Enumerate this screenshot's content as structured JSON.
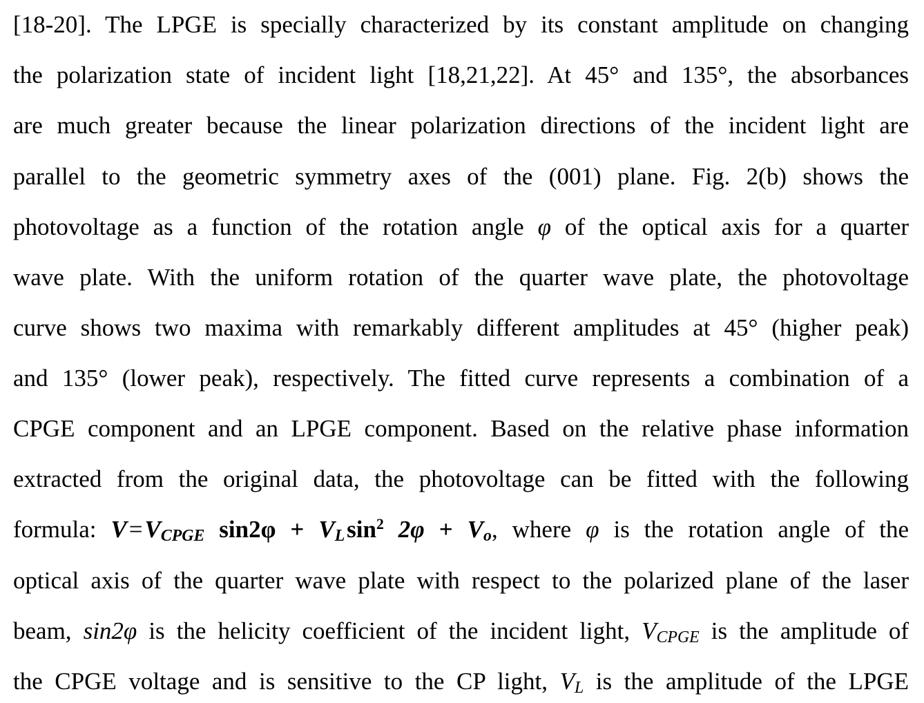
{
  "paragraph": {
    "lines": [
      "[18-20]. The LPGE is specially characterized by its constant amplitude on changing",
      "the polarization state of incident light [18,21,22]. At 45° and 135°, the absorbances",
      "are much greater because the linear polarization directions of the incident light are",
      "parallel to the geometric symmetry axes of the (001) plane. Fig. 2(b) shows the",
      "photovoltage as a function of the rotation angle",
      "φ",
      "of the optical axis for a quarter",
      "wave plate. With the uniform rotation of the quarter wave plate, the photovoltage",
      "curve shows two maxima with remarkably different amplitudes at 45° (higher peak)",
      "and 135° (lower peak), respectively. The fitted curve represents a combination of a",
      "CPGE component and an LPGE component. Based on the relative phase information",
      "extracted from the original data, the photovoltage can be fitted with the following",
      "formula:",
      "where",
      "φ",
      "is the rotation angle of the",
      "optical axis of the quarter wave plate with respect to the polarized plane of the laser",
      "beam,",
      "sin2φ",
      "is the helicity coefficient of the incident light,",
      "V",
      "CPGE",
      "is the amplitude of",
      "the CPGE voltage and is sensitive to the CP light,",
      "V",
      "L",
      "is the amplitude of the LPGE"
    ],
    "formula": {
      "V": "V",
      "eq": "=",
      "V_cpge": "V",
      "cpge_sub": "CPGE",
      "sin2phi": "sin2φ",
      "plus1": "+",
      "V_L": "V",
      "L_sub": "L",
      "sin": "sin",
      "sq": "2",
      "twophi": "2φ",
      "plus2": "+",
      "V_o": "V",
      "o_sub": "o",
      "comma": ","
    }
  }
}
